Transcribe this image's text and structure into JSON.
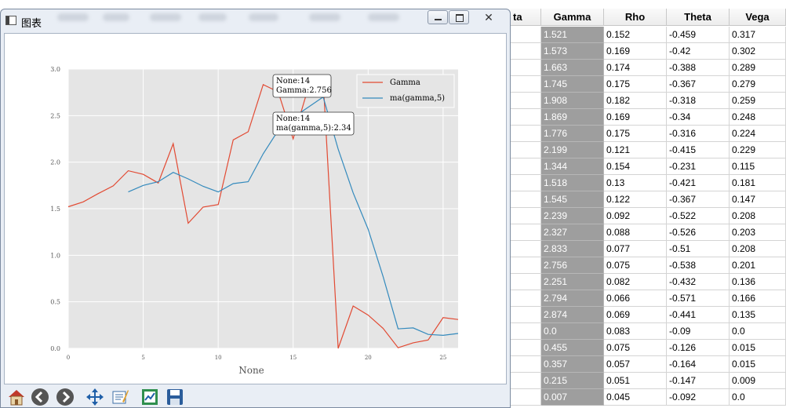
{
  "window": {
    "title": "图表",
    "close_glyph": "✕"
  },
  "sheet": {
    "headers": [
      "ta",
      "Gamma",
      "Rho",
      "Theta",
      "Vega"
    ],
    "rows": [
      [
        "1.521",
        "0.152",
        "-0.459",
        "0.317"
      ],
      [
        "1.573",
        "0.169",
        "-0.42",
        "0.302"
      ],
      [
        "1.663",
        "0.174",
        "-0.388",
        "0.289"
      ],
      [
        "1.745",
        "0.175",
        "-0.367",
        "0.279"
      ],
      [
        "1.908",
        "0.182",
        "-0.318",
        "0.259"
      ],
      [
        "1.869",
        "0.169",
        "-0.34",
        "0.248"
      ],
      [
        "1.776",
        "0.175",
        "-0.316",
        "0.224"
      ],
      [
        "2.199",
        "0.121",
        "-0.415",
        "0.229"
      ],
      [
        "1.344",
        "0.154",
        "-0.231",
        "0.115"
      ],
      [
        "1.518",
        "0.13",
        "-0.421",
        "0.181"
      ],
      [
        "1.545",
        "0.122",
        "-0.367",
        "0.147"
      ],
      [
        "2.239",
        "0.092",
        "-0.522",
        "0.208"
      ],
      [
        "2.327",
        "0.088",
        "-0.526",
        "0.203"
      ],
      [
        "2.833",
        "0.077",
        "-0.51",
        "0.208"
      ],
      [
        "2.756",
        "0.075",
        "-0.538",
        "0.201"
      ],
      [
        "2.251",
        "0.082",
        "-0.432",
        "0.136"
      ],
      [
        "2.794",
        "0.066",
        "-0.571",
        "0.166"
      ],
      [
        "2.874",
        "0.069",
        "-0.441",
        "0.135"
      ],
      [
        "0.0",
        "0.083",
        "-0.09",
        "0.0"
      ],
      [
        "0.455",
        "0.075",
        "-0.126",
        "0.015"
      ],
      [
        "0.357",
        "0.057",
        "-0.164",
        "0.015"
      ],
      [
        "0.215",
        "0.051",
        "-0.147",
        "0.009"
      ],
      [
        "0.007",
        "0.045",
        "-0.092",
        "0.0"
      ]
    ]
  },
  "toolbar": {
    "buttons": [
      "home-icon",
      "back-icon",
      "forward-icon",
      "pan-icon",
      "configure-icon",
      "zoom-rect-icon",
      "save-icon"
    ]
  },
  "colors": {
    "gamma": "#e24a33",
    "ma": "#348abd",
    "plot_bg": "#e5e5e5",
    "gamma_column": "#9e9e9e"
  },
  "chart_data": {
    "type": "line",
    "xlabel": "None",
    "ylabel": "",
    "xlim": [
      0,
      26
    ],
    "ylim": [
      0,
      3.0
    ],
    "x_ticks": [
      "0",
      "5",
      "10",
      "15",
      "20",
      "25"
    ],
    "y_ticks": [
      "0.0",
      "0.5",
      "1.0",
      "1.5",
      "2.0",
      "2.5",
      "3.0"
    ],
    "grid": true,
    "legend": "top-right",
    "series": [
      {
        "name": "Gamma",
        "x": [
          0,
          1,
          2,
          3,
          4,
          5,
          6,
          7,
          8,
          9,
          10,
          11,
          12,
          13,
          14,
          15,
          16,
          17,
          18,
          19,
          20,
          21,
          22,
          23,
          24,
          25,
          26
        ],
        "values": [
          1.521,
          1.573,
          1.663,
          1.745,
          1.908,
          1.869,
          1.776,
          2.199,
          1.344,
          1.518,
          1.545,
          2.239,
          2.327,
          2.833,
          2.756,
          2.251,
          2.794,
          2.874,
          0.0,
          0.455,
          0.357,
          0.215,
          0.007,
          0.06,
          0.09,
          0.33,
          0.31
        ]
      },
      {
        "name": "ma(gamma,5)",
        "x": [
          4,
          5,
          6,
          7,
          8,
          9,
          10,
          11,
          12,
          13,
          14,
          15,
          16,
          17,
          18,
          19,
          20,
          21,
          22,
          23,
          24,
          25,
          26
        ],
        "values": [
          1.68,
          1.75,
          1.79,
          1.89,
          1.82,
          1.74,
          1.68,
          1.77,
          1.79,
          2.09,
          2.34,
          2.48,
          2.59,
          2.7,
          2.14,
          1.67,
          1.28,
          0.77,
          0.21,
          0.22,
          0.15,
          0.14,
          0.16
        ]
      }
    ],
    "annotations": [
      {
        "lines": [
          "None:14",
          "Gamma:2.756"
        ]
      },
      {
        "lines": [
          "None:14",
          "ma(gamma,5):2.34"
        ]
      }
    ]
  }
}
